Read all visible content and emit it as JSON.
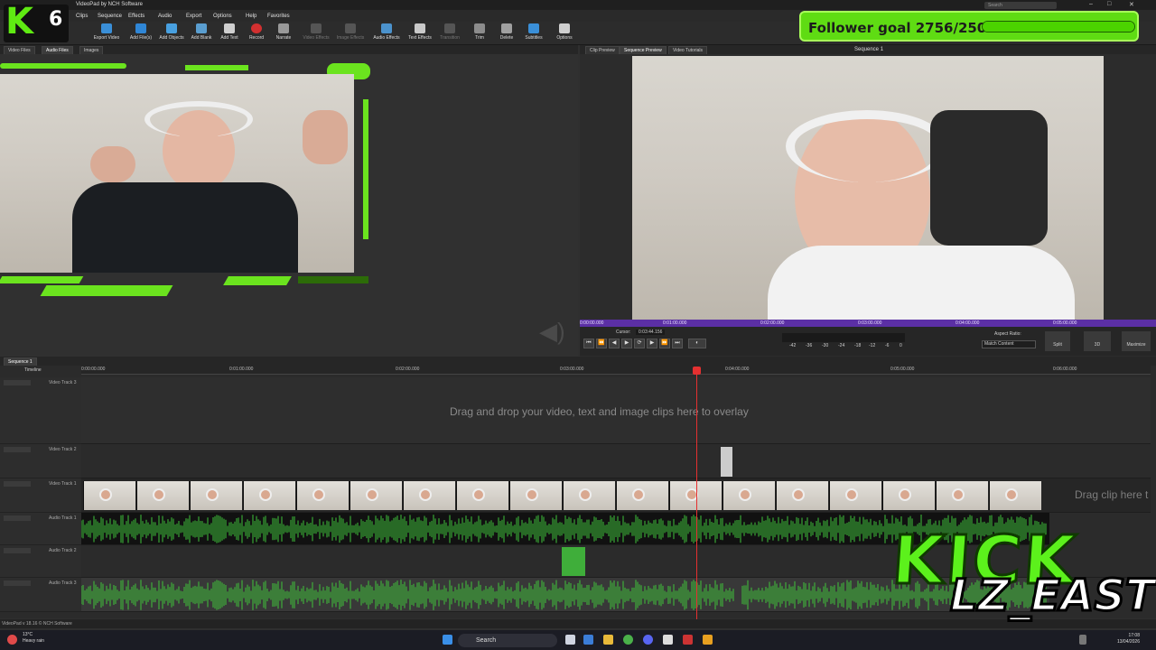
{
  "app": {
    "title": "VideoPad by NCH Software",
    "version": "VideoPad v 18.16 © NCH Software"
  },
  "menu": [
    "Clips",
    "Sequence",
    "Effects",
    "Audio",
    "Export",
    "Options",
    "Help",
    "Favorites"
  ],
  "search_placeholder": "Search",
  "toolbar": [
    {
      "label": "Export Video",
      "icon": "export-video-icon"
    },
    {
      "label": "Add File(s)",
      "icon": "add-files-icon"
    },
    {
      "label": "Add Objects",
      "icon": "add-objects-icon"
    },
    {
      "label": "Add Blank",
      "icon": "add-blank-icon"
    },
    {
      "label": "Add Text",
      "icon": "add-text-icon"
    },
    {
      "label": "Record",
      "icon": "record-icon"
    },
    {
      "label": "Narrate",
      "icon": "narrate-icon"
    },
    {
      "label": "Video Effects",
      "icon": "video-effects-icon"
    },
    {
      "label": "Image Effects",
      "icon": "image-effects-icon"
    },
    {
      "label": "Audio Effects",
      "icon": "audio-effects-icon"
    },
    {
      "label": "Text Effects",
      "icon": "text-effects-icon"
    },
    {
      "label": "Transition",
      "icon": "transition-icon"
    },
    {
      "label": "Trim",
      "icon": "trim-icon"
    },
    {
      "label": "Delete",
      "icon": "delete-icon"
    },
    {
      "label": "Subtitles",
      "icon": "subtitles-icon"
    },
    {
      "label": "Options",
      "icon": "options-icon"
    }
  ],
  "bin_tabs": [
    "Video Files",
    "Audio Files",
    "Images"
  ],
  "preview_tabs": [
    "Clip Preview",
    "Sequence Preview",
    "Video Tutorials"
  ],
  "sequence_title": "Sequence 1",
  "preview_ruler": [
    "0:00:00.000",
    "0:01:00.000",
    "0:02:00.000",
    "0:03:00.000",
    "0:04:00.000",
    "0:05:00.000"
  ],
  "transport": {
    "cursor_label": "Cursor:",
    "cursor_value": "0:03:44.156",
    "aspect_label": "Aspect Ratio:",
    "aspect_value": "Match Content",
    "split_label": "Split",
    "threed_label": "3D",
    "maximize_label": "Maximize",
    "meter_ticks": [
      "-42",
      "-36",
      "-30",
      "-24",
      "-18",
      "-12",
      "-6",
      "0"
    ]
  },
  "timeline": {
    "sequence_tab": "Sequence 1",
    "timeline_label": "Timeline",
    "ruler": [
      "0:00:00.000",
      "0:01:00.000",
      "0:02:00.000",
      "0:03:00.000",
      "0:04:00.000",
      "0:05:00.000",
      "0:06:00.000"
    ],
    "tracks": [
      "Video Track 3",
      "Video Track 2",
      "Video Track 1",
      "Audio Track 1",
      "Audio Track 2",
      "Audio Track 3"
    ],
    "overlay_hint": "Drag and drop your video, text and image clips here to overlay",
    "right_hint": "Drag clip here t"
  },
  "overlay": {
    "follower_goal": "Follower goal 2756/2500",
    "follower_progress": 1.0,
    "badge_letter": "K",
    "badge_number": "6",
    "kick_logo": "KICK",
    "channel": "LZ_EAST"
  },
  "taskbar": {
    "weather_temp": "13°C",
    "weather_desc": "Heavy rain",
    "search": "Search",
    "time": "17:08",
    "date": "13/04/2026"
  },
  "colors": {
    "accent_green": "#5fdc13",
    "playhead": "#e53030",
    "scrubber": "#5b2fa5",
    "waveform": "#3fc43a"
  }
}
